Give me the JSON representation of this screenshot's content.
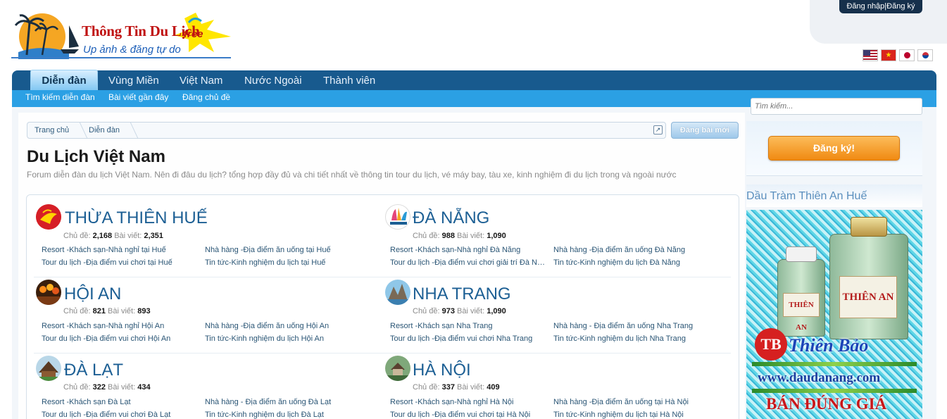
{
  "brand": {
    "title": "Thông Tin Du Lịch",
    "free": "free",
    "subtitle": "Up ảnh & đăng tự do",
    "colors": {
      "red": "#c01212",
      "blue": "#1d5fb8"
    }
  },
  "account": {
    "login_label": "Đăng nhập|Đăng ký"
  },
  "languages": [
    {
      "icon": "us-flag-icon"
    },
    {
      "icon": "vn-flag-icon"
    },
    {
      "icon": "jp-flag-icon"
    },
    {
      "icon": "kr-flag-icon"
    }
  ],
  "nav": {
    "tabs": [
      {
        "label": "Diễn đàn",
        "active": true
      },
      {
        "label": "Vùng Miền"
      },
      {
        "label": "Việt Nam"
      },
      {
        "label": "Nước Ngoài"
      },
      {
        "label": "Thành viên"
      }
    ],
    "subnav": [
      {
        "label": "Tìm kiếm diễn đàn"
      },
      {
        "label": "Bài viết gần đây"
      },
      {
        "label": "Đăng chủ đề"
      }
    ],
    "colors": {
      "bar": "#185a8e",
      "subbar": "#2ba0e4"
    }
  },
  "breadcrumb": {
    "items": [
      {
        "label": "Trang chủ"
      },
      {
        "label": "Diễn đàn"
      }
    ]
  },
  "post_button": {
    "label": "Đăng bài mới"
  },
  "page": {
    "title": "Du Lịch Việt Nam",
    "description": "Forum diễn đàn du lịch Việt Nam. Nên đi đâu du lịch? tổng hợp đầy đủ và chi tiết nhất về thông tin tour du lịch, vé máy bay, tàu xe, kinh nghiệm đi du lịch trong và ngoài nước"
  },
  "stats_labels": {
    "threads": "Chủ đề:",
    "posts": "Bài viết:"
  },
  "nodes": [
    {
      "title": "THỪA THIÊN HUẾ",
      "threads": "2,168",
      "posts": "2,351",
      "links": [
        "Resort -Khách sạn-Nhà nghỉ tại Huế",
        "Nhà hàng -Địa điểm ăn uống tại Huế",
        "Tour du lịch -Địa điểm vui chơi tại Huế",
        "Tin tức-Kinh nghiệm du lịch tại Huế"
      ]
    },
    {
      "title": "ĐÀ NẴNG",
      "threads": "988",
      "posts": "1,090",
      "links": [
        "Resort -Khách sạn-Nhà nghỉ Đà Nẵng",
        "Nhà hàng -Địa điểm ăn uống Đà Nẵng",
        "Tour du lịch -Địa điểm vui chơi giải trí Đà N…",
        "Tin tức-Kinh nghiệm du lịch Đà Nẵng"
      ]
    },
    {
      "title": "HỘI AN",
      "threads": "821",
      "posts": "893",
      "links": [
        "Resort -Khách sạn-Nhà nghỉ Hội An",
        "Nhà hàng -Địa điểm ăn uống Hội An",
        "Tour du lịch -Địa điểm vui chơi Hội An",
        "Tin tức-Kinh nghiệm du lịch Hội An"
      ]
    },
    {
      "title": "NHA TRANG",
      "threads": "973",
      "posts": "1,090",
      "links": [
        "Resort -Khách sạn Nha Trang",
        "Nhà hàng - Địa điểm ăn uống Nha Trang",
        "Tour du lịch -Địa điểm vui chơi Nha Trang",
        "Tin tức-Kinh nghiệm du lịch Nha Trang"
      ]
    },
    {
      "title": "ĐÀ LẠT",
      "threads": "322",
      "posts": "434",
      "links": [
        "Resort -Khách sạn Đà Lạt",
        "Nhà hàng - Địa điểm ăn uống Đà Lạt",
        "Tour du lịch -Địa điểm vui chơi Đà Lạt",
        "Tin tức-Kinh nghiệm du lịch Đà Lạt"
      ]
    },
    {
      "title": "HÀ NỘI",
      "threads": "337",
      "posts": "409",
      "links": [
        "Resort -Khách sạn-Nhà nghỉ Hà Nội",
        "Nhà hàng -Địa điểm ăn uống tại Hà Nội",
        "Tour du lịch -Địa điểm vui chơi tại Hà Nội",
        "Tin tức-Kinh nghiệm du lịch tại Hà Nội"
      ]
    }
  ],
  "sidebar": {
    "search_placeholder": "Tìm kiếm...",
    "signup_label": "Đăng ký!",
    "ad_heading": "Dầu Tràm Thiên An Huế",
    "ad": {
      "label_small": "THIÊN AN",
      "label_large": "THIÊN AN",
      "tb": "TB",
      "brand": "Thiên Bảo",
      "url": "www.daudanang.com",
      "slogan": "BÁN ĐÚNG GIÁ"
    }
  }
}
